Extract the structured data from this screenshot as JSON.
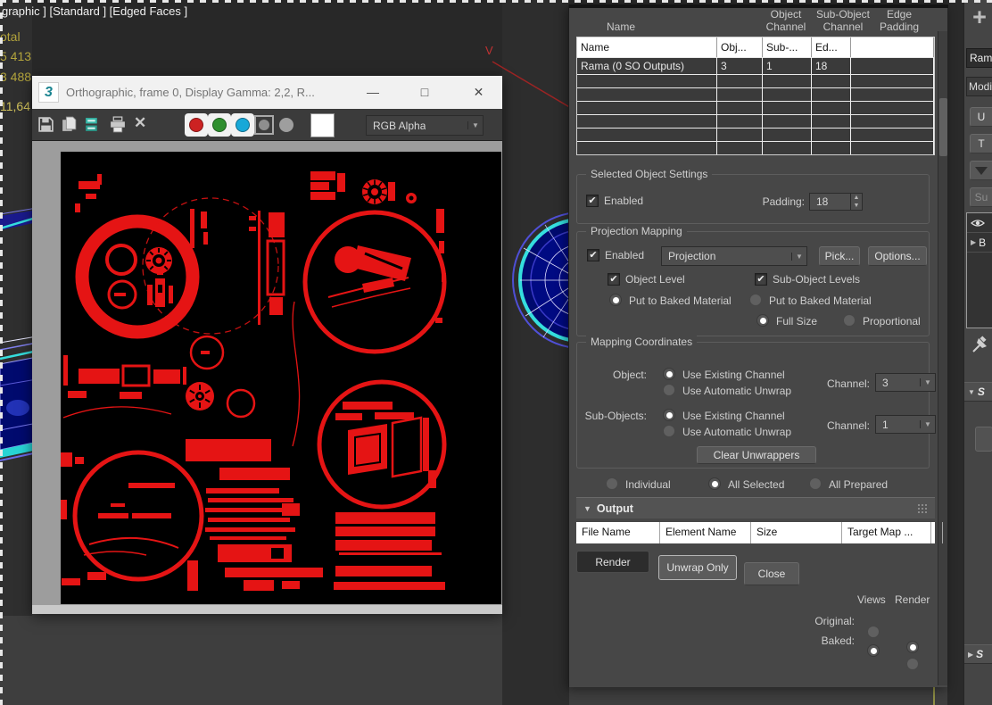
{
  "colors": {
    "uv_red": "#e51414",
    "image_bg": "#000000",
    "dialog_bg": "#474747",
    "viewport_bg": "#3e3e3e",
    "title_bar": "#f1f1f1",
    "channel_red": "#cc2222",
    "channel_green": "#2f8f2f",
    "channel_blue": "#17a8d8",
    "wireframe_blue": "#000a6e",
    "wireframe_cyan": "#35dede",
    "stats_yellow": "#b3a43c"
  },
  "viewport": {
    "label_line": "graphic ] [Standard ] [Edged Faces ]",
    "stats": [
      "otal",
      "5 413",
      "3 488"
    ],
    "stat_highlight": "11,64",
    "gizmo_label": "V"
  },
  "render_window": {
    "title": "Orthographic, frame 0, Display Gamma: 2,2, R...",
    "logo": "3",
    "channel_mode": "RGB Alpha",
    "controls": {
      "minimize": "—",
      "maximize": "□",
      "close": "✕"
    },
    "icons": [
      "save-icon",
      "copy-icon",
      "clone-icon",
      "print-icon",
      "delete-icon",
      "red-channel-toggle",
      "green-channel-toggle",
      "blue-channel-toggle",
      "alpha-channel-toggle",
      "monochrome-toggle",
      "background-color-swatch"
    ]
  },
  "dialog": {
    "columns_header": {
      "name": "Name",
      "object_channel": "Object Channel",
      "sub_object_channel": "Sub-Object Channel",
      "edge_padding": "Edge Padding"
    },
    "table": {
      "header": [
        "Name",
        "Obj...",
        "Sub-...",
        "Ed..."
      ],
      "row": {
        "name": "Rama (0 SO Outputs)",
        "obj": "3",
        "sub": "1",
        "edge": "18"
      }
    },
    "selected_object_settings": {
      "title": "Selected Object Settings",
      "enabled": "Enabled",
      "padding_label": "Padding:",
      "padding_value": "18"
    },
    "projection_mapping": {
      "title": "Projection Mapping",
      "enabled": "Enabled",
      "modifier": "Projection",
      "pick": "Pick...",
      "options": "Options...",
      "object_level": "Object Level",
      "sub_object_levels": "Sub-Object Levels",
      "put_to_baked": "Put to Baked Material",
      "full_size": "Full Size",
      "proportional": "Proportional"
    },
    "mapping_coordinates": {
      "title": "Mapping Coordinates",
      "object": "Object:",
      "sub_objects": "Sub-Objects:",
      "use_existing": "Use Existing Channel",
      "use_automatic": "Use Automatic Unwrap",
      "channel": "Channel:",
      "object_channel": "3",
      "sub_object_channel": "1",
      "clear": "Clear Unwrappers"
    },
    "scope": {
      "individual": "Individual",
      "all_selected": "All Selected",
      "all_prepared": "All Prepared"
    },
    "output": {
      "title": "Output",
      "columns": [
        "File Name",
        "Element Name",
        "Size",
        "Target Map ..."
      ]
    },
    "buttons": {
      "render": "Render",
      "unwrap_only": "Unwrap Only",
      "close": "Close"
    },
    "views_render": {
      "views": "Views",
      "render": "Render",
      "original": "Original:",
      "baked": "Baked:"
    }
  },
  "command_panel": {
    "object_name": "Rama",
    "modifier_list": "Modif",
    "btn_u": "U",
    "btn_t": "T",
    "btn_su": "Su",
    "stack_item": "B",
    "rollout_open": "S",
    "rollout_closed": "S"
  }
}
